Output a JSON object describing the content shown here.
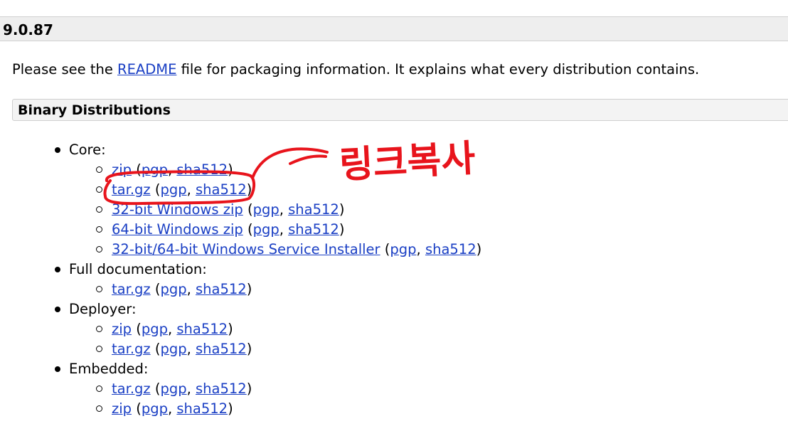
{
  "version": "9.0.87",
  "intro": {
    "before": "Please see the ",
    "readme": "README",
    "after": " file for packaging information. It explains what every distribution contains."
  },
  "section_title": "Binary Distributions",
  "categories": [
    {
      "label": "Core:",
      "items": [
        {
          "main": "zip",
          "pgp": "pgp",
          "sha": "sha512"
        },
        {
          "main": "tar.gz",
          "pgp": "pgp",
          "sha": "sha512"
        },
        {
          "main": "32-bit Windows zip",
          "pgp": "pgp",
          "sha": "sha512"
        },
        {
          "main": "64-bit Windows zip",
          "pgp": "pgp",
          "sha": "sha512"
        },
        {
          "main": "32-bit/64-bit Windows Service Installer",
          "pgp": "pgp",
          "sha": "sha512"
        }
      ]
    },
    {
      "label": "Full documentation:",
      "items": [
        {
          "main": "tar.gz",
          "pgp": "pgp",
          "sha": "sha512"
        }
      ]
    },
    {
      "label": "Deployer:",
      "items": [
        {
          "main": "zip",
          "pgp": "pgp",
          "sha": "sha512"
        },
        {
          "main": "tar.gz",
          "pgp": "pgp",
          "sha": "sha512"
        }
      ]
    },
    {
      "label": "Embedded:",
      "items": [
        {
          "main": "tar.gz",
          "pgp": "pgp",
          "sha": "sha512"
        },
        {
          "main": "zip",
          "pgp": "pgp",
          "sha": "sha512"
        }
      ]
    }
  ],
  "punct": {
    "open": " (",
    "sep": ", ",
    "close": ")"
  },
  "annotation": {
    "text": "링크복사",
    "color": "#e8141c",
    "highlighted_item": "tar.gz"
  }
}
